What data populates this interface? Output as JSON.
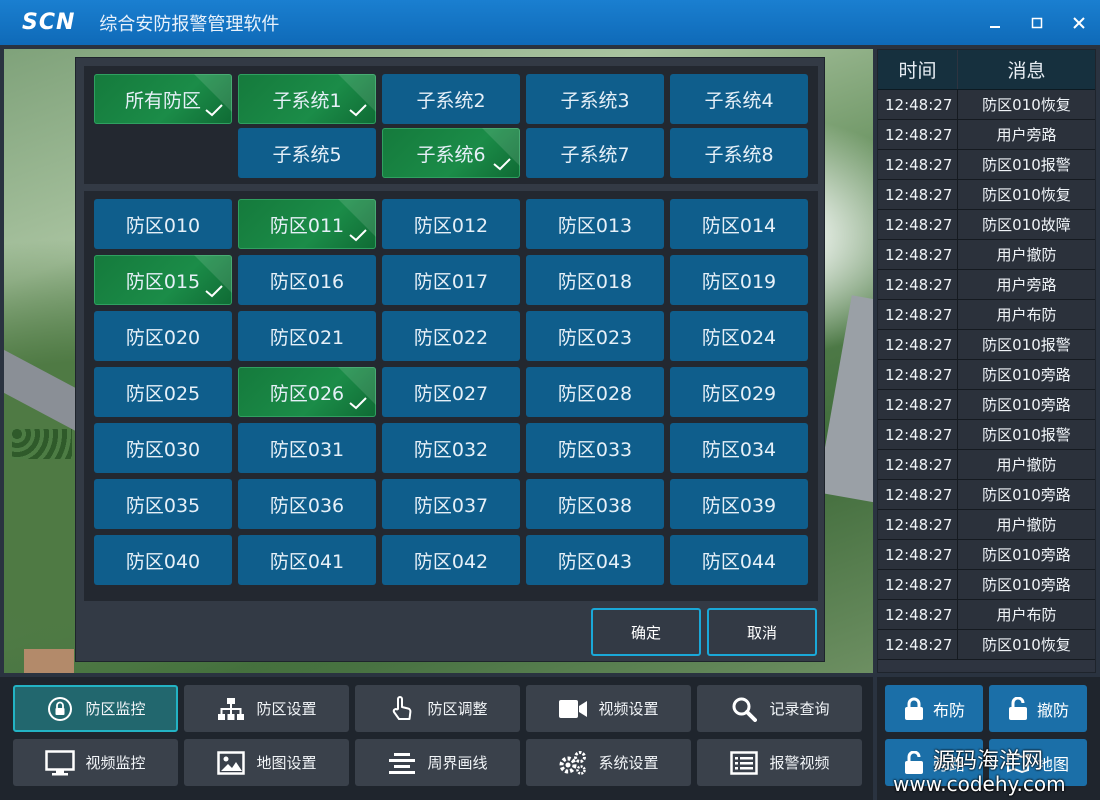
{
  "app": {
    "logo": "SCN",
    "title": "综合安防报警管理软件"
  },
  "window_controls": {
    "minimize": "–",
    "maximize": "□",
    "close": "✕"
  },
  "subsystems": [
    {
      "label": "所有防区",
      "selected": true
    },
    {
      "label": "子系统1",
      "selected": true
    },
    {
      "label": "子系统2",
      "selected": false
    },
    {
      "label": "子系统3",
      "selected": false
    },
    {
      "label": "子系统4",
      "selected": false
    },
    {
      "label": "子系统5",
      "selected": false
    },
    {
      "label": "子系统6",
      "selected": true
    },
    {
      "label": "子系统7",
      "selected": false
    },
    {
      "label": "子系统8",
      "selected": false
    }
  ],
  "zones": [
    {
      "label": "防区010",
      "selected": false
    },
    {
      "label": "防区011",
      "selected": true
    },
    {
      "label": "防区012",
      "selected": false
    },
    {
      "label": "防区013",
      "selected": false
    },
    {
      "label": "防区014",
      "selected": false
    },
    {
      "label": "防区015",
      "selected": true
    },
    {
      "label": "防区016",
      "selected": false
    },
    {
      "label": "防区017",
      "selected": false
    },
    {
      "label": "防区018",
      "selected": false
    },
    {
      "label": "防区019",
      "selected": false
    },
    {
      "label": "防区020",
      "selected": false
    },
    {
      "label": "防区021",
      "selected": false
    },
    {
      "label": "防区022",
      "selected": false
    },
    {
      "label": "防区023",
      "selected": false
    },
    {
      "label": "防区024",
      "selected": false
    },
    {
      "label": "防区025",
      "selected": false
    },
    {
      "label": "防区026",
      "selected": true
    },
    {
      "label": "防区027",
      "selected": false
    },
    {
      "label": "防区028",
      "selected": false
    },
    {
      "label": "防区029",
      "selected": false
    },
    {
      "label": "防区030",
      "selected": false
    },
    {
      "label": "防区031",
      "selected": false
    },
    {
      "label": "防区032",
      "selected": false
    },
    {
      "label": "防区033",
      "selected": false
    },
    {
      "label": "防区034",
      "selected": false
    },
    {
      "label": "防区035",
      "selected": false
    },
    {
      "label": "防区036",
      "selected": false
    },
    {
      "label": "防区037",
      "selected": false
    },
    {
      "label": "防区038",
      "selected": false
    },
    {
      "label": "防区039",
      "selected": false
    },
    {
      "label": "防区040",
      "selected": false
    },
    {
      "label": "防区041",
      "selected": false
    },
    {
      "label": "防区042",
      "selected": false
    },
    {
      "label": "防区043",
      "selected": false
    },
    {
      "label": "防区044",
      "selected": false
    }
  ],
  "dialog": {
    "confirm": "确定",
    "cancel": "取消"
  },
  "log": {
    "headers": [
      "时间",
      "消息"
    ],
    "rows": [
      [
        "12:48:27",
        "防区010恢复"
      ],
      [
        "12:48:27",
        "用户旁路"
      ],
      [
        "12:48:27",
        "防区010报警"
      ],
      [
        "12:48:27",
        "防区010恢复"
      ],
      [
        "12:48:27",
        "防区010故障"
      ],
      [
        "12:48:27",
        "用户撤防"
      ],
      [
        "12:48:27",
        "用户旁路"
      ],
      [
        "12:48:27",
        "用户布防"
      ],
      [
        "12:48:27",
        "防区010报警"
      ],
      [
        "12:48:27",
        "防区010旁路"
      ],
      [
        "12:48:27",
        "防区010旁路"
      ],
      [
        "12:48:27",
        "防区010报警"
      ],
      [
        "12:48:27",
        "用户撤防"
      ],
      [
        "12:48:27",
        "防区010旁路"
      ],
      [
        "12:48:27",
        "用户撤防"
      ],
      [
        "12:48:27",
        "防区010旁路"
      ],
      [
        "12:48:27",
        "防区010旁路"
      ],
      [
        "12:48:27",
        "用户布防"
      ],
      [
        "12:48:27",
        "防区010恢复"
      ]
    ]
  },
  "nav": [
    {
      "label": "防区监控",
      "icon": "lock-circle-icon",
      "active": true
    },
    {
      "label": "防区设置",
      "icon": "hierarchy-icon",
      "active": false
    },
    {
      "label": "防区调整",
      "icon": "hand-pointer-icon",
      "active": false
    },
    {
      "label": "视频设置",
      "icon": "video-camera-icon",
      "active": false
    },
    {
      "label": "记录查询",
      "icon": "search-icon",
      "active": false
    },
    {
      "label": "视频监控",
      "icon": "monitor-icon",
      "active": false
    },
    {
      "label": "地图设置",
      "icon": "image-icon",
      "active": false
    },
    {
      "label": "周界画线",
      "icon": "align-center-icon",
      "active": false
    },
    {
      "label": "系统设置",
      "icon": "gears-icon",
      "active": false
    },
    {
      "label": "报警视频",
      "icon": "list-icon",
      "active": false
    }
  ],
  "actions": [
    {
      "label": "布防",
      "icon": "lock-icon"
    },
    {
      "label": "撤防",
      "icon": "unlock-icon"
    },
    {
      "label": "旁路",
      "icon": "unlock-icon"
    },
    {
      "label": "地图",
      "icon": "map-icon"
    }
  ],
  "watermark": {
    "line1": "源码海洋网",
    "line2": "www.codehy.com"
  },
  "colors": {
    "titlebar": "#1273c2",
    "zone_default": "#0f5e8c",
    "zone_selected": "#1b8c48",
    "accent_border": "#1aa8d8"
  }
}
